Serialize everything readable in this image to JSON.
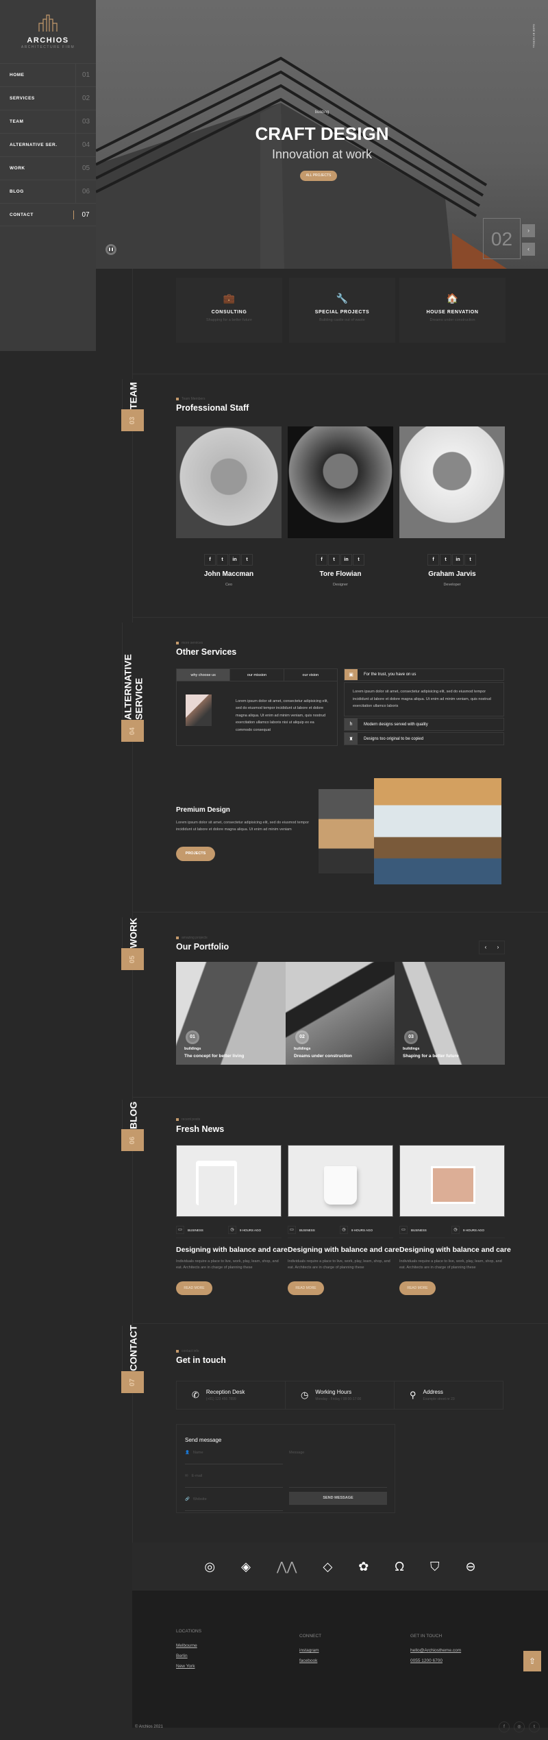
{
  "brand": {
    "name": "ARCHIOS",
    "tagline": "ARCHITECTURE FIRM"
  },
  "nav": [
    {
      "label": "HOME",
      "num": "01"
    },
    {
      "label": "SERVICES",
      "num": "02"
    },
    {
      "label": "TEAM",
      "num": "03"
    },
    {
      "label": "ALTERNATIVE SER.",
      "num": "04"
    },
    {
      "label": "WORK",
      "num": "05"
    },
    {
      "label": "BLOG",
      "num": "06"
    },
    {
      "label": "CONTACT",
      "num": "07",
      "active": true
    }
  ],
  "hero": {
    "kicker": "building",
    "title": "CRAFT DESIGN",
    "subtitle": "Innovation at work",
    "button": "ALL PROJECTS",
    "slide": "02",
    "scroll_text": "SLIDE BY SCROLL"
  },
  "services": [
    {
      "icon": "briefcase-icon",
      "title": "CONSULTING",
      "text": "Shapping for a better future"
    },
    {
      "icon": "wrench-icon",
      "title": "SPECIAL PROJECTS",
      "text": "Building castle out of waste"
    },
    {
      "icon": "house-renovation-icon",
      "title": "HOUSE RENVATION",
      "text": "Dreams under construction"
    }
  ],
  "team": {
    "label": "TEAM",
    "num": "03",
    "kicker": "Team Members",
    "title": "Professional Staff",
    "social": [
      "f",
      "t",
      "in",
      "t"
    ],
    "members": [
      {
        "name": "John Maccman",
        "role": "Ceo"
      },
      {
        "name": "Tore Flowian",
        "role": "Designer"
      },
      {
        "name": "Graham Jarvis",
        "role": "Developer"
      }
    ]
  },
  "alt": {
    "label": "ALTERNATIVE SERVICE",
    "num": "04",
    "kicker": "more services",
    "title": "Other Services",
    "tabs": [
      "why choose us",
      "our mission",
      "our vision"
    ],
    "tab_text": "Lorem ipsum dolor sit amet, consectetur adipisicing elit, sed do eiusmod tempor incididunt ut labore et dolore magna aliqua. Ut enim ad minim veniam, quis nostrud exercitation ullamco laboris nisi ut aliquip ex ea commodo consequat",
    "accordion": [
      {
        "title": "For the trust, you have on us",
        "text": "Lorem ipsum dolor sit amet, consectetur adipisicing elit, sed do eiusmod tempor incididunt ut labore et dolore magna aliqua. Ut enim ad minim veniam, quis nostrud exercitation ullamco laboris"
      },
      {
        "title": "Modern designs served with quality"
      },
      {
        "title": "Designs too original to be copied"
      }
    ],
    "premium": {
      "title": "Premium Design",
      "text": "Lorem ipsum dolor sit amet, consectetur adipisicing elit, sed do eiusmod tempor incididunt ut labore et dolore magna aliqua. Ut enim ad minim veniam",
      "button": "PROJECTS"
    }
  },
  "work": {
    "label": "WORK",
    "num": "05",
    "kicker": "amazing projects",
    "title": "Our Portfolio",
    "items": [
      {
        "num": "01",
        "cat": "buildings",
        "title": "The concept for better living"
      },
      {
        "num": "02",
        "cat": "buildings",
        "title": "Dreams under construction"
      },
      {
        "num": "03",
        "cat": "buildings",
        "title": "Shaping for a better future"
      }
    ]
  },
  "blog": {
    "label": "BLOG",
    "num": "06",
    "kicker": "recent posts",
    "title": "Fresh News",
    "posts": [
      {
        "cat": "BUSINESS",
        "time": "9 HOURS AGO",
        "title": "Designing with balance and care",
        "text": "Individuals require a place to live, work, play, learn, shop, and eat. Architects are in charge of planning these",
        "button": "READ MORE"
      },
      {
        "cat": "BUSINESS",
        "time": "9 HOURS AGO",
        "title": "Designing with balance and care",
        "text": "Individuals require a place to live, work, play, learn, shop, and eat. Architects are in charge of planning these",
        "button": "READ MORE"
      },
      {
        "cat": "BUSINESS",
        "time": "9 HOURS AGO",
        "title": "Designing with balance and care",
        "text": "Individuals require a place to live, work, play, learn, shop, and eat. Architects are in charge of planning these",
        "button": "READ MORE"
      }
    ]
  },
  "contact": {
    "label": "CONTACT",
    "num": "07",
    "kicker": "contact info",
    "title": "Get in touch",
    "info": [
      {
        "title": "Reception Desk",
        "text": "(+01) 123 456 7899"
      },
      {
        "title": "Working Hours",
        "text": "Monday - Friday / 08:00-17:00"
      },
      {
        "title": "Address",
        "text": "Example street nr 23"
      }
    ],
    "form": {
      "title": "Send message",
      "name": "Name",
      "email": "E-mail",
      "website": "Website",
      "message": "Message",
      "button": "SEND MESSAGE"
    }
  },
  "footer": {
    "locations_title": "LOCATIONS",
    "locations": [
      "Melbourne",
      "Berlin",
      "New York"
    ],
    "connect_title": "CONNECT",
    "connect": [
      "instagram",
      "facebook"
    ],
    "touch_title": "GET IN TOUCH",
    "email": "hello@Archiostheme.com",
    "phone": "0055 1200 6700",
    "copyright": "© Archios 2021"
  },
  "colors": {
    "accent": "#c49a6c",
    "background": "#282828",
    "sidebar": "#3b3b3b"
  }
}
